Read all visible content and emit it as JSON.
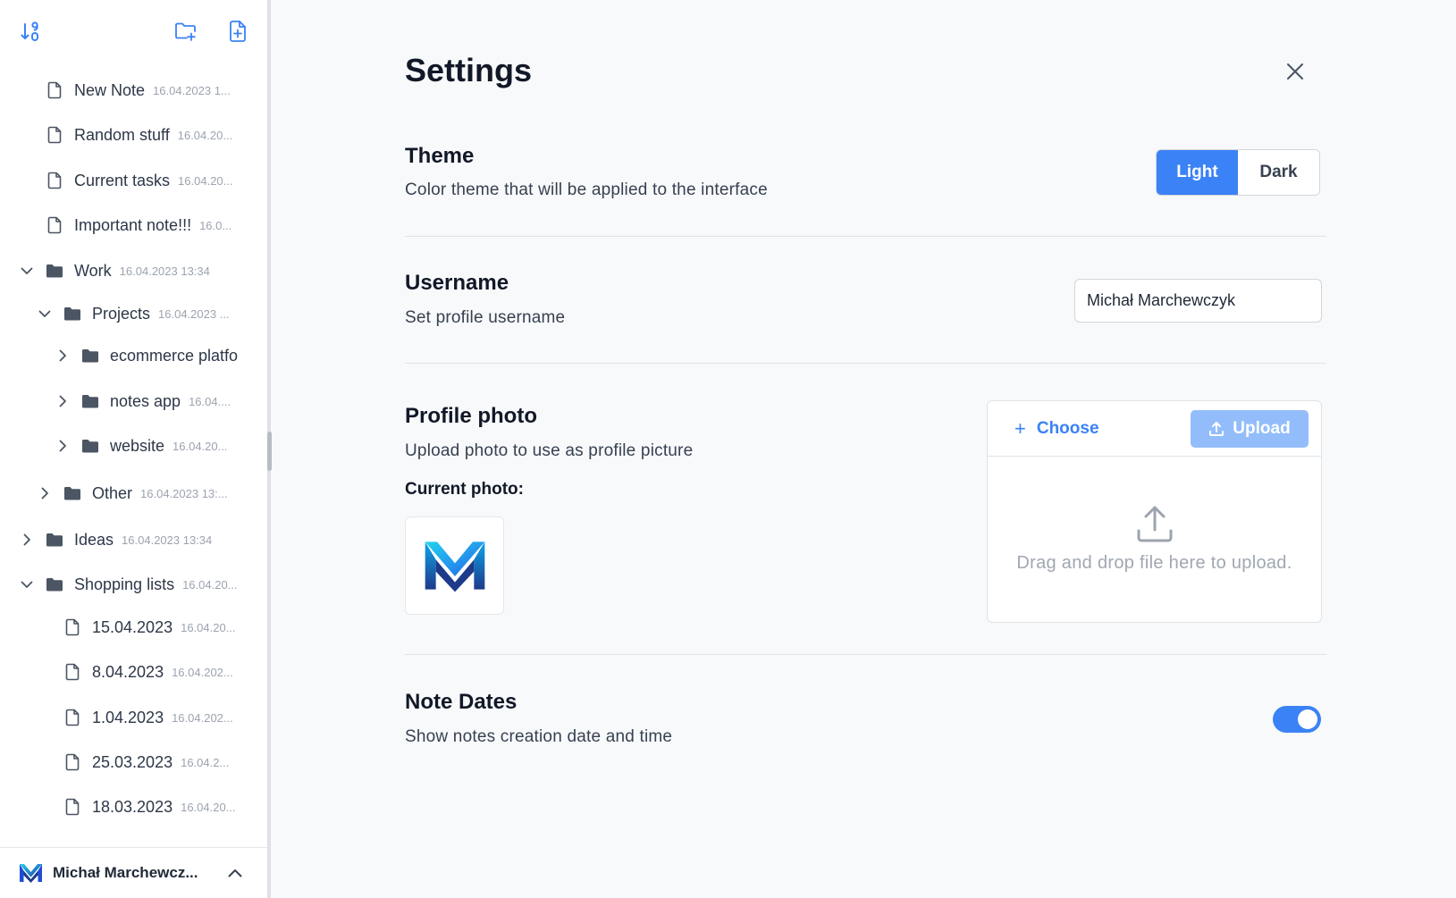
{
  "sidebar": {
    "tree": [
      {
        "name": "New Note",
        "date": "16.04.2023 1...",
        "type": "file",
        "level": 0,
        "expanded": null
      },
      {
        "name": "Random stuff",
        "date": "16.04.20...",
        "type": "file",
        "level": 0,
        "expanded": null
      },
      {
        "name": "Current tasks",
        "date": "16.04.20...",
        "type": "file",
        "level": 0,
        "expanded": null
      },
      {
        "name": "Important note!!!",
        "date": "16.0...",
        "type": "file",
        "level": 0,
        "expanded": null
      },
      {
        "name": "Work",
        "date": "16.04.2023 13:34",
        "type": "folder",
        "level": 0,
        "expanded": true
      },
      {
        "name": "Projects",
        "date": "16.04.2023 ...",
        "type": "folder",
        "level": 1,
        "expanded": true
      },
      {
        "name": "ecommerce platfo",
        "date": "",
        "type": "folder",
        "level": 2,
        "expanded": false
      },
      {
        "name": "notes app",
        "date": "16.04....",
        "type": "folder",
        "level": 2,
        "expanded": false
      },
      {
        "name": "website",
        "date": "16.04.20...",
        "type": "folder",
        "level": 2,
        "expanded": false
      },
      {
        "name": "Other",
        "date": "16.04.2023 13:...",
        "type": "folder",
        "level": 1,
        "expanded": false
      },
      {
        "name": "Ideas",
        "date": "16.04.2023 13:34",
        "type": "folder",
        "level": 0,
        "expanded": false
      },
      {
        "name": "Shopping lists",
        "date": "16.04.20...",
        "type": "folder",
        "level": 0,
        "expanded": true
      },
      {
        "name": "15.04.2023",
        "date": "16.04.20...",
        "type": "file",
        "level": 1,
        "expanded": null
      },
      {
        "name": "8.04.2023",
        "date": "16.04.202...",
        "type": "file",
        "level": 1,
        "expanded": null
      },
      {
        "name": "1.04.2023",
        "date": "16.04.202...",
        "type": "file",
        "level": 1,
        "expanded": null
      },
      {
        "name": "25.03.2023",
        "date": "16.04.2...",
        "type": "file",
        "level": 1,
        "expanded": null
      },
      {
        "name": "18.03.2023",
        "date": "16.04.20...",
        "type": "file",
        "level": 1,
        "expanded": null
      }
    ],
    "user": {
      "name": "Michał Marchewcz..."
    }
  },
  "settings": {
    "title": "Settings",
    "theme": {
      "title": "Theme",
      "description": "Color theme that will be applied to the interface",
      "options": [
        "Light",
        "Dark"
      ],
      "selected": "Light"
    },
    "username": {
      "title": "Username",
      "description": "Set profile username",
      "value": "Michał Marchewczyk"
    },
    "photo": {
      "title": "Profile photo",
      "description": "Upload photo to use as profile picture",
      "current_label": "Current photo:",
      "choose_label": "Choose",
      "upload_label": "Upload",
      "drop_text": "Drag and drop file here to upload."
    },
    "note_dates": {
      "title": "Note Dates",
      "description": "Show notes creation date and time",
      "enabled": true
    }
  },
  "colors": {
    "accent": "#3b82f6",
    "upload_disabled": "#93bdfa",
    "logo_light": "#22d3ee",
    "logo_dark": "#1e3a8a"
  },
  "icons": {
    "sort": "sort-numeric-icon",
    "new_folder": "folder-plus-icon",
    "new_file": "file-plus-icon",
    "close": "close-icon",
    "upload": "upload-icon",
    "chevron_up": "chevron-up-icon"
  }
}
